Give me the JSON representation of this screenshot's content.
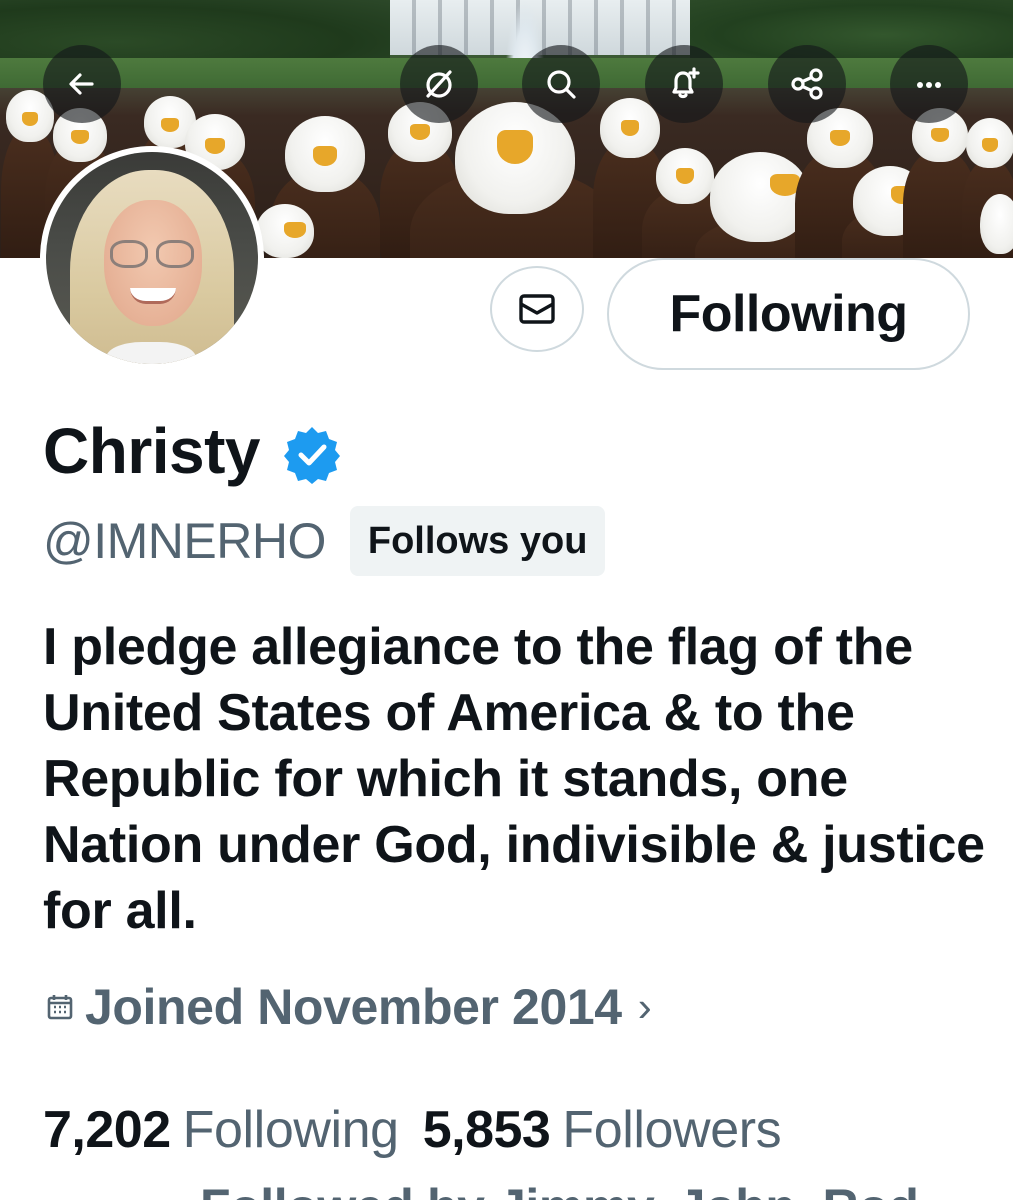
{
  "banner": {
    "description_icon": "eagles-banner-image"
  },
  "toolbar": {
    "back_icon": "back-arrow-icon",
    "grok_icon": "grok-icon",
    "search_icon": "search-icon",
    "notify_icon": "bell-plus-icon",
    "share_icon": "share-icon",
    "more_icon": "more-icon",
    "more_label": "···"
  },
  "profile": {
    "name": "Christy",
    "handle": "@IMNERHO",
    "follows_you": "Follows you",
    "bio": "I pledge allegiance to the flag of the United States of America & to the Republic for which it stands, one Nation under God, indivisible & justice for all.",
    "joined": "Joined November 2014",
    "joined_chevron": "›",
    "following_count": "7,202",
    "following_label": "Following",
    "followers_count": "5,853",
    "followers_label": "Followers",
    "followed_by": "Followed by Jimmy, John, Rod"
  },
  "actions": {
    "message_icon": "envelope-icon",
    "follow_state_label": "Following"
  },
  "colors": {
    "verified": "#1d9bf0",
    "secondary_text": "#536471",
    "primary_text": "#0f1419",
    "badge_bg": "#eff3f4"
  }
}
